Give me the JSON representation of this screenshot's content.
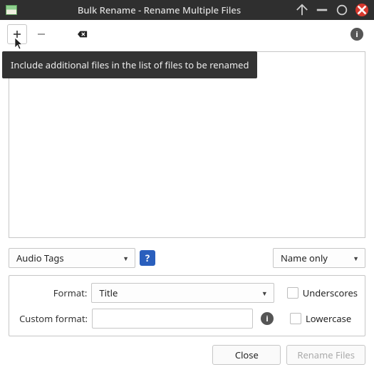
{
  "window": {
    "title": "Bulk Rename - Rename Multiple Files"
  },
  "tooltip": {
    "add_files": "Include additional files in the list of files to be renamed"
  },
  "renamer": {
    "mode_label": "Audio Tags",
    "view_label": "Name only"
  },
  "panel": {
    "format_label": "Format:",
    "format_value": "Title",
    "custom_format_label": "Custom format:",
    "custom_format_value": "",
    "underscores_label": "Underscores",
    "lowercase_label": "Lowercase"
  },
  "footer": {
    "close": "Close",
    "rename": "Rename Files"
  }
}
